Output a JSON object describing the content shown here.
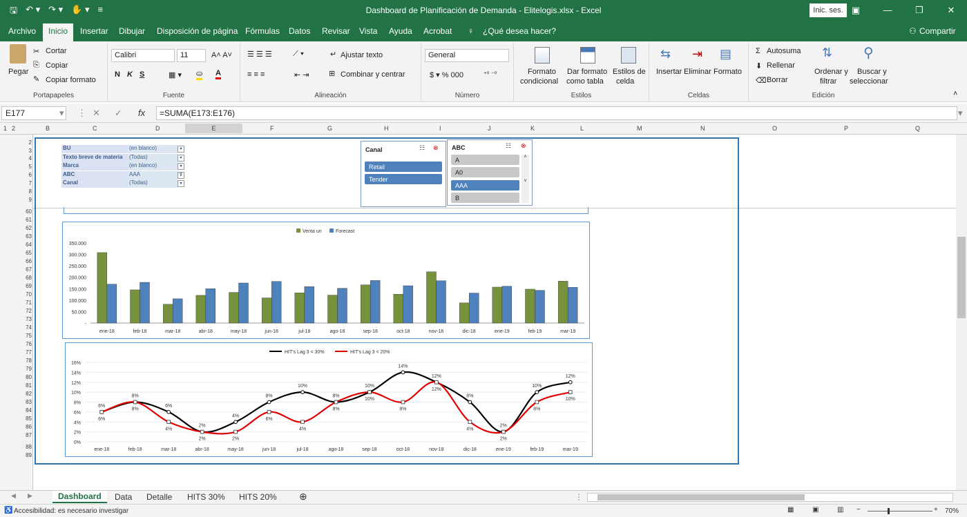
{
  "window": {
    "title": "Dashboard de Planificación de Demanda - Elitelogis.xlsx  -  Excel",
    "signin": "Inic. ses."
  },
  "menu": {
    "tabs": [
      "Archivo",
      "Inicio",
      "Insertar",
      "Dibujar",
      "Disposición de página",
      "Fórmulas",
      "Datos",
      "Revisar",
      "Vista",
      "Ayuda",
      "Acrobat",
      "¿Qué desea hacer?"
    ],
    "share": "Compartir"
  },
  "ribbon": {
    "clipboard": {
      "paste": "Pegar",
      "cut": "Cortar",
      "copy": "Copiar",
      "format_painter": "Copiar formato",
      "label": "Portapapeles"
    },
    "font": {
      "name": "Calibri",
      "size": "11",
      "bold": "N",
      "italic": "K",
      "underline": "S",
      "label": "Fuente"
    },
    "alignment": {
      "wrap": "Ajustar texto",
      "merge": "Combinar y centrar",
      "label": "Alineación"
    },
    "number": {
      "format": "General",
      "label": "Número"
    },
    "styles": {
      "conditional_1": "Formato",
      "conditional_2": "condicional",
      "as_table_1": "Dar formato",
      "as_table_2": "como tabla",
      "cell_styles_1": "Estilos de",
      "cell_styles_2": "celda",
      "label": "Estilos"
    },
    "cells": {
      "insert": "Insertar",
      "delete": "Eliminar",
      "format": "Formato",
      "label": "Celdas"
    },
    "editing": {
      "autosum": "Autosuma",
      "fill": "Rellenar",
      "clear": "Borrar",
      "sort_1": "Ordenar y",
      "sort_2": "filtrar",
      "find_1": "Buscar y",
      "find_2": "seleccionar",
      "label": "Edición"
    }
  },
  "formula": {
    "cell": "E177",
    "content": "=SUMA(E173:E176)"
  },
  "columns": [
    "B",
    "C",
    "D",
    "E",
    "F",
    "G",
    "H",
    "I",
    "J",
    "K",
    "L",
    "M",
    "N",
    "O",
    "P",
    "Q"
  ],
  "rows": [
    "2",
    "3",
    "4",
    "5",
    "6",
    "7",
    "8",
    "9",
    "60",
    "61",
    "62",
    "63",
    "64",
    "65",
    "66",
    "67",
    "68",
    "69",
    "70",
    "71",
    "72",
    "73",
    "74",
    "75",
    "76",
    "77",
    "78",
    "79",
    "80",
    "81",
    "82",
    "83",
    "84",
    "85",
    "86",
    "87",
    "88",
    "89"
  ],
  "outline": [
    "1",
    "2"
  ],
  "pivot_filters": [
    {
      "key": "BU",
      "value": "(en blanco)"
    },
    {
      "key": "Texto breve de materia",
      "value": "(Todas)"
    },
    {
      "key": "Marca",
      "value": "(en blanco)"
    },
    {
      "key": "ABC",
      "value": "AAA"
    },
    {
      "key": "Canal",
      "value": "(Todas)"
    }
  ],
  "slicer_canal": {
    "title": "Canal",
    "items": [
      "Retail",
      "Tender"
    ]
  },
  "slicer_abc": {
    "title": "ABC",
    "items": [
      "A",
      "A0",
      "AAA",
      "B"
    ],
    "selected": "AAA"
  },
  "chart_data": [
    {
      "type": "bar",
      "categories": [
        "ene-18",
        "feb-18",
        "mar-18",
        "abr-18",
        "may-18",
        "jun-18",
        "jul-18",
        "ago-18",
        "sep-18",
        "oct-18",
        "nov-18",
        "dic-18",
        "ene-19",
        "feb-19",
        "mar-19"
      ],
      "series": [
        {
          "name": "Venta un",
          "color": "#76923c",
          "values": [
            308000,
            145000,
            82000,
            121000,
            134000,
            110000,
            132000,
            122000,
            167000,
            126000,
            224000,
            88000,
            157000,
            148000,
            183000
          ]
        },
        {
          "name": "Forecast",
          "color": "#4f81bd",
          "values": [
            170000,
            178000,
            106000,
            150000,
            175000,
            182000,
            159000,
            152000,
            186000,
            163000,
            185000,
            131000,
            161000,
            143000,
            156000
          ]
        }
      ],
      "ylim": [
        0,
        350000
      ],
      "yticks": [
        "-",
        "50.000",
        "100.000",
        "150.000",
        "200.000",
        "250.000",
        "300.000",
        "350.000"
      ],
      "legend": "top"
    },
    {
      "type": "line",
      "categories": [
        "ene-18",
        "feb-18",
        "mar-18",
        "abr-18",
        "may-18",
        "jun-18",
        "jul-18",
        "ago-18",
        "sep-18",
        "oct-18",
        "nov-18",
        "dic-18",
        "ene-19",
        "feb-19",
        "mar-19"
      ],
      "series": [
        {
          "name": "HIT's Lag 3 < 30%",
          "color": "#000000",
          "values": [
            6,
            8,
            6,
            2,
            4,
            8,
            10,
            8,
            10,
            14,
            12,
            8,
            2,
            10,
            12
          ]
        },
        {
          "name": "HIT's Lag 3 < 20%",
          "color": "#e00000",
          "values": [
            6,
            8,
            4,
            2,
            2,
            6,
            4,
            8,
            10,
            8,
            12,
            4,
            2,
            8,
            10
          ]
        }
      ],
      "ylim": [
        0,
        16
      ],
      "yticks": [
        "0%",
        "2%",
        "4%",
        "6%",
        "8%",
        "10%",
        "12%",
        "14%",
        "16%"
      ],
      "legend": "top"
    }
  ],
  "sheet_tabs": [
    "Dashboard",
    "Data",
    "Detalle",
    "HITS 30%",
    "HITS 20%"
  ],
  "status": {
    "accessibility": "Accesibilidad: es necesario investigar",
    "zoom": "70%"
  }
}
